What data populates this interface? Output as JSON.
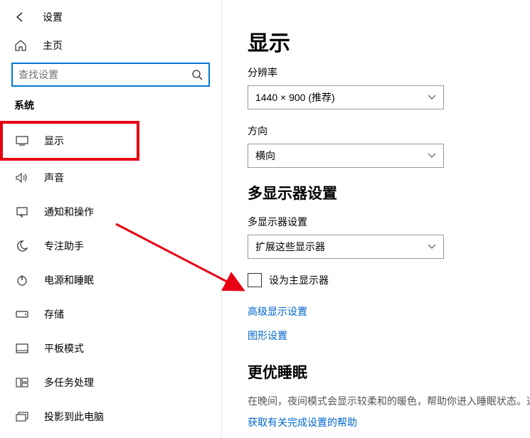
{
  "header": {
    "title": "设置"
  },
  "home": {
    "label": "主页"
  },
  "search": {
    "placeholder": "查找设置"
  },
  "section_label": "系统",
  "nav": [
    {
      "key": "display",
      "label": "显示"
    },
    {
      "key": "sound",
      "label": "声音"
    },
    {
      "key": "notifications",
      "label": "通知和操作"
    },
    {
      "key": "focus",
      "label": "专注助手"
    },
    {
      "key": "power",
      "label": "电源和睡眠"
    },
    {
      "key": "storage",
      "label": "存储"
    },
    {
      "key": "tablet",
      "label": "平板模式"
    },
    {
      "key": "multitask",
      "label": "多任务处理"
    },
    {
      "key": "project",
      "label": "投影到此电脑"
    }
  ],
  "main": {
    "page_title": "显示",
    "resolution": {
      "label": "分辨率",
      "value": "1440 × 900 (推荐)"
    },
    "orientation": {
      "label": "方向",
      "value": "横向"
    },
    "multi_display": {
      "heading": "多显示器设置",
      "label": "多显示器设置",
      "value": "扩展这些显示器",
      "checkbox_label": "设为主显示器",
      "advanced_link": "高级显示设置",
      "graphics_link": "图形设置"
    },
    "sleep": {
      "heading": "更优睡眠",
      "body": "在晚间，夜间模式会显示较柔和的暖色，帮助你进入睡眠状态。选",
      "help_link": "获取有关完成设置的帮助"
    }
  }
}
